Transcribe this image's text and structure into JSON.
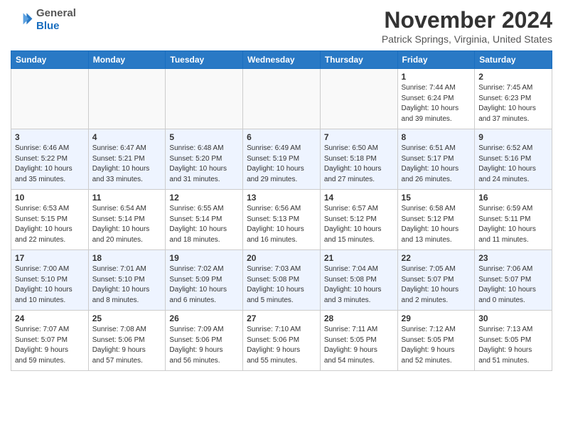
{
  "header": {
    "logo": {
      "line1": "General",
      "line2": "Blue"
    },
    "title": "November 2024",
    "location": "Patrick Springs, Virginia, United States"
  },
  "days_of_week": [
    "Sunday",
    "Monday",
    "Tuesday",
    "Wednesday",
    "Thursday",
    "Friday",
    "Saturday"
  ],
  "weeks": [
    [
      {
        "day": "",
        "info": ""
      },
      {
        "day": "",
        "info": ""
      },
      {
        "day": "",
        "info": ""
      },
      {
        "day": "",
        "info": ""
      },
      {
        "day": "",
        "info": ""
      },
      {
        "day": "1",
        "info": "Sunrise: 7:44 AM\nSunset: 6:24 PM\nDaylight: 10 hours\nand 39 minutes."
      },
      {
        "day": "2",
        "info": "Sunrise: 7:45 AM\nSunset: 6:23 PM\nDaylight: 10 hours\nand 37 minutes."
      }
    ],
    [
      {
        "day": "3",
        "info": "Sunrise: 6:46 AM\nSunset: 5:22 PM\nDaylight: 10 hours\nand 35 minutes."
      },
      {
        "day": "4",
        "info": "Sunrise: 6:47 AM\nSunset: 5:21 PM\nDaylight: 10 hours\nand 33 minutes."
      },
      {
        "day": "5",
        "info": "Sunrise: 6:48 AM\nSunset: 5:20 PM\nDaylight: 10 hours\nand 31 minutes."
      },
      {
        "day": "6",
        "info": "Sunrise: 6:49 AM\nSunset: 5:19 PM\nDaylight: 10 hours\nand 29 minutes."
      },
      {
        "day": "7",
        "info": "Sunrise: 6:50 AM\nSunset: 5:18 PM\nDaylight: 10 hours\nand 27 minutes."
      },
      {
        "day": "8",
        "info": "Sunrise: 6:51 AM\nSunset: 5:17 PM\nDaylight: 10 hours\nand 26 minutes."
      },
      {
        "day": "9",
        "info": "Sunrise: 6:52 AM\nSunset: 5:16 PM\nDaylight: 10 hours\nand 24 minutes."
      }
    ],
    [
      {
        "day": "10",
        "info": "Sunrise: 6:53 AM\nSunset: 5:15 PM\nDaylight: 10 hours\nand 22 minutes."
      },
      {
        "day": "11",
        "info": "Sunrise: 6:54 AM\nSunset: 5:14 PM\nDaylight: 10 hours\nand 20 minutes."
      },
      {
        "day": "12",
        "info": "Sunrise: 6:55 AM\nSunset: 5:14 PM\nDaylight: 10 hours\nand 18 minutes."
      },
      {
        "day": "13",
        "info": "Sunrise: 6:56 AM\nSunset: 5:13 PM\nDaylight: 10 hours\nand 16 minutes."
      },
      {
        "day": "14",
        "info": "Sunrise: 6:57 AM\nSunset: 5:12 PM\nDaylight: 10 hours\nand 15 minutes."
      },
      {
        "day": "15",
        "info": "Sunrise: 6:58 AM\nSunset: 5:12 PM\nDaylight: 10 hours\nand 13 minutes."
      },
      {
        "day": "16",
        "info": "Sunrise: 6:59 AM\nSunset: 5:11 PM\nDaylight: 10 hours\nand 11 minutes."
      }
    ],
    [
      {
        "day": "17",
        "info": "Sunrise: 7:00 AM\nSunset: 5:10 PM\nDaylight: 10 hours\nand 10 minutes."
      },
      {
        "day": "18",
        "info": "Sunrise: 7:01 AM\nSunset: 5:10 PM\nDaylight: 10 hours\nand 8 minutes."
      },
      {
        "day": "19",
        "info": "Sunrise: 7:02 AM\nSunset: 5:09 PM\nDaylight: 10 hours\nand 6 minutes."
      },
      {
        "day": "20",
        "info": "Sunrise: 7:03 AM\nSunset: 5:08 PM\nDaylight: 10 hours\nand 5 minutes."
      },
      {
        "day": "21",
        "info": "Sunrise: 7:04 AM\nSunset: 5:08 PM\nDaylight: 10 hours\nand 3 minutes."
      },
      {
        "day": "22",
        "info": "Sunrise: 7:05 AM\nSunset: 5:07 PM\nDaylight: 10 hours\nand 2 minutes."
      },
      {
        "day": "23",
        "info": "Sunrise: 7:06 AM\nSunset: 5:07 PM\nDaylight: 10 hours\nand 0 minutes."
      }
    ],
    [
      {
        "day": "24",
        "info": "Sunrise: 7:07 AM\nSunset: 5:07 PM\nDaylight: 9 hours\nand 59 minutes."
      },
      {
        "day": "25",
        "info": "Sunrise: 7:08 AM\nSunset: 5:06 PM\nDaylight: 9 hours\nand 57 minutes."
      },
      {
        "day": "26",
        "info": "Sunrise: 7:09 AM\nSunset: 5:06 PM\nDaylight: 9 hours\nand 56 minutes."
      },
      {
        "day": "27",
        "info": "Sunrise: 7:10 AM\nSunset: 5:06 PM\nDaylight: 9 hours\nand 55 minutes."
      },
      {
        "day": "28",
        "info": "Sunrise: 7:11 AM\nSunset: 5:05 PM\nDaylight: 9 hours\nand 54 minutes."
      },
      {
        "day": "29",
        "info": "Sunrise: 7:12 AM\nSunset: 5:05 PM\nDaylight: 9 hours\nand 52 minutes."
      },
      {
        "day": "30",
        "info": "Sunrise: 7:13 AM\nSunset: 5:05 PM\nDaylight: 9 hours\nand 51 minutes."
      }
    ]
  ]
}
